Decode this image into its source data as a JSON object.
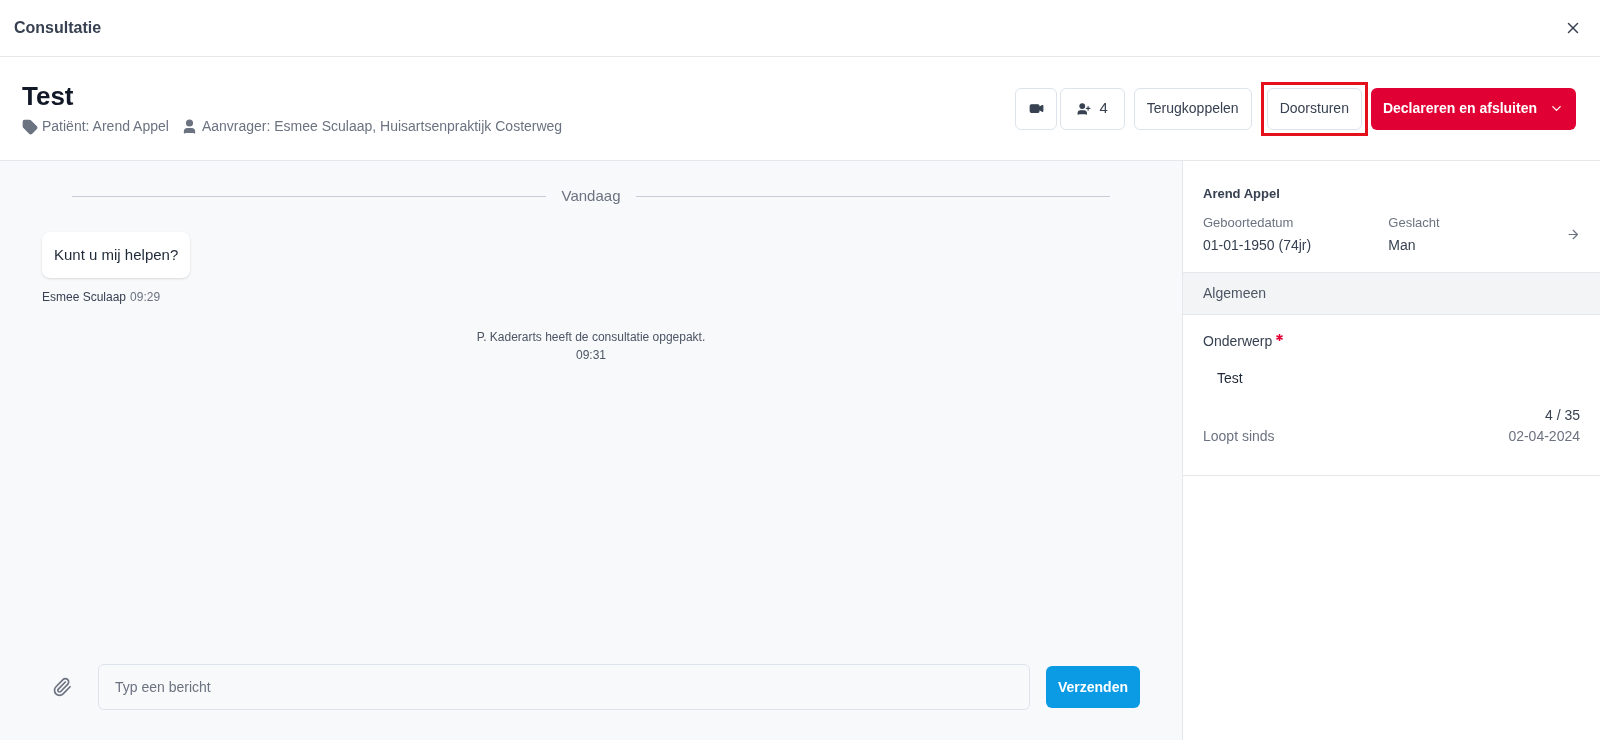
{
  "window": {
    "title": "Consultatie"
  },
  "header": {
    "title": "Test",
    "patient": "Patiënt: Arend Appel",
    "requester": "Aanvrager: Esmee Sculaap, Huisartsenpraktijk Costerweg"
  },
  "actions": [
    {
      "kind": "video"
    },
    {
      "kind": "participants",
      "label": "4"
    },
    {
      "kind": "plain",
      "label": "Terugkoppelen",
      "highlighted": false
    },
    {
      "kind": "plain",
      "label": "Doorsturen",
      "highlighted": true
    },
    {
      "kind": "primary",
      "label": "Declareren en afsluiten"
    }
  ],
  "chat": {
    "divider": "Vandaag",
    "messages": [
      {
        "kind": "bubble",
        "text": "Kunt u mij helpen?",
        "author": "Esmee Sculaap",
        "time": "09:29"
      },
      {
        "kind": "system",
        "text": "P. Kaderarts heeft de consultatie opgepakt.",
        "time": "09:31"
      }
    ],
    "composer": {
      "placeholder": "Typ een bericht",
      "send": "Verzenden"
    }
  },
  "panel": {
    "name": "Arend Appel",
    "fields": [
      {
        "label": "Geboortedatum",
        "value": "01-01-1950 (74jr)"
      },
      {
        "label": "Geslacht",
        "value": "Man"
      }
    ],
    "section": "Algemeen",
    "subject_label": "Onderwerp",
    "required": true,
    "subject_value": "Test",
    "counter": "4 / 35",
    "since_label": "Loopt sinds",
    "since_value": "02-04-2024"
  }
}
